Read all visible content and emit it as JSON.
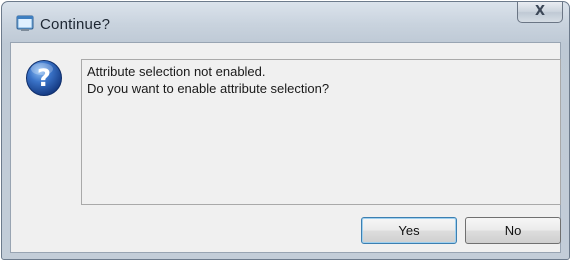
{
  "window": {
    "title": "Continue?",
    "close_glyph": "X"
  },
  "icons": {
    "app": "dialog-window-icon",
    "message": "question-icon"
  },
  "message": {
    "line1": "Attribute selection not enabled.",
    "line2": "Do you want to enable attribute selection?"
  },
  "buttons": {
    "yes_label": "Yes",
    "no_label": "No"
  },
  "colors": {
    "frame": "#c3cdd8",
    "client": "#f0f0f0",
    "question_blue": "#2a5aa8",
    "default_button_border": "#3c7fb1"
  }
}
